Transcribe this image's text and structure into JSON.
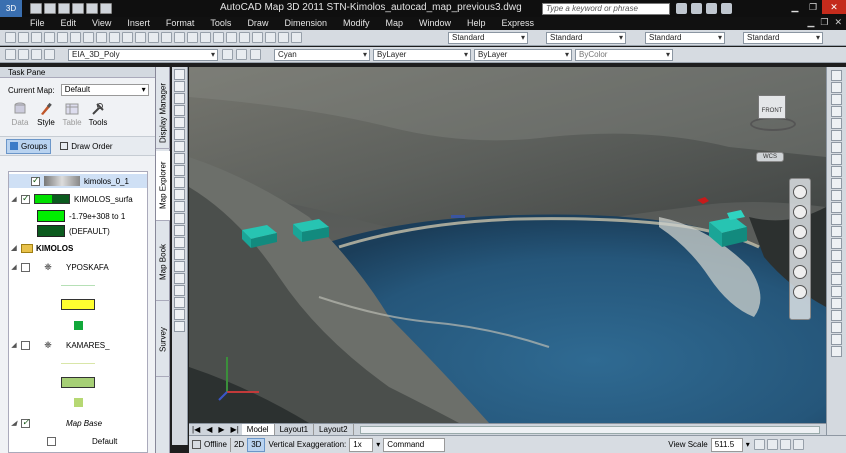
{
  "titlebar": {
    "title": "AutoCAD Map 3D 2011  STN-Kimolos_autocad_map_previous3.dwg",
    "app_button": "3D",
    "search_placeholder": "Type a keyword or phrase"
  },
  "menu": [
    "File",
    "Edit",
    "View",
    "Insert",
    "Format",
    "Tools",
    "Draw",
    "Dimension",
    "Modify",
    "Map",
    "Window",
    "Help",
    "Express"
  ],
  "toolbar1": {
    "styles": [
      "Standard",
      "Standard",
      "Standard",
      "Standard"
    ]
  },
  "toolbar2": {
    "layer": "EIA_3D_Poly",
    "color": "Cyan",
    "linetype": "ByLayer",
    "lineweight": "ByLayer",
    "plotstyle": "ByColor"
  },
  "taskpane": {
    "title": "Task Pane",
    "current_map_label": "Current Map:",
    "current_map_value": "Default",
    "tools": [
      {
        "label": "Data",
        "enabled": false
      },
      {
        "label": "Style",
        "enabled": true
      },
      {
        "label": "Table",
        "enabled": false
      },
      {
        "label": "Tools",
        "enabled": true
      }
    ],
    "groups_label": "Groups",
    "draw_order_label": "Draw Order",
    "layers": [
      {
        "label": "kimolos_0_1",
        "indent": 1,
        "checked": true,
        "selected": true
      },
      {
        "label": "KIMOLOS_surfa",
        "indent": 1,
        "checked": true
      },
      {
        "label": "-1.79e+308 to 1",
        "indent": 2,
        "swatch": "#00ee00"
      },
      {
        "label": "(DEFAULT)",
        "indent": 2,
        "swatch": "#0b5a1e"
      },
      {
        "label": "KIMOLOS",
        "indent": 0,
        "group": true
      },
      {
        "label": "YPOSKAFA",
        "indent": 1,
        "checked": false
      },
      {
        "label": "KAMARES_",
        "indent": 1,
        "checked": false
      },
      {
        "label": "Map Base",
        "indent": 1,
        "checked": true,
        "italic": true
      },
      {
        "label": "Default",
        "indent": 2,
        "checked": false
      }
    ],
    "side_tabs": [
      "Display Manager",
      "Map Explorer",
      "Map Book",
      "Survey"
    ]
  },
  "viewcube": {
    "face": "FRONT",
    "wcs": "WCS"
  },
  "layout_tabs": [
    "Model",
    "Layout1",
    "Layout2"
  ],
  "status": {
    "offline": "Offline",
    "mode2d": "2D",
    "mode3d": "3D",
    "vert_exag_label": "Vertical Exaggeration:",
    "vert_exag_value": "1x",
    "command": "Command",
    "view_scale_label": "View Scale",
    "view_scale_value": "511.5"
  },
  "colors": {
    "water": "#2a5c82",
    "terrain": "#6b6a64",
    "teal": "#1aa597",
    "bar": "#d6dbe1"
  }
}
